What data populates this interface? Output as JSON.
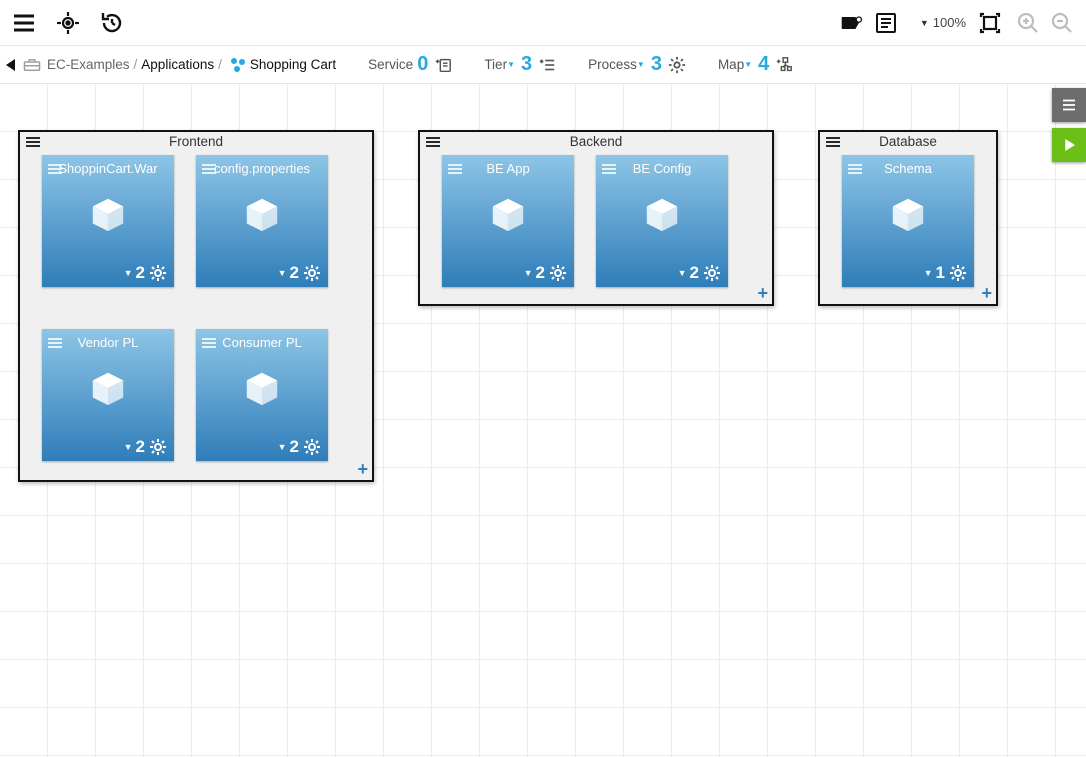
{
  "toolbar": {
    "zoom": "100%"
  },
  "breadcrumb": {
    "root": "EC-Examples",
    "mid": "Applications",
    "leaf": "Shopping Cart",
    "sep": "/"
  },
  "stats": {
    "service": {
      "label": "Service",
      "count": "0"
    },
    "tier": {
      "label": "Tier",
      "count": "3"
    },
    "process": {
      "label": "Process",
      "count": "3"
    },
    "map": {
      "label": "Map",
      "count": "4"
    }
  },
  "tiers": [
    {
      "name": "Frontend",
      "components": [
        {
          "title": "ShoppinCart.War",
          "count": "2"
        },
        {
          "title": "config.properties",
          "count": "2"
        },
        {
          "title": "Vendor PL",
          "count": "2"
        },
        {
          "title": "Consumer PL",
          "count": "2"
        }
      ]
    },
    {
      "name": "Backend",
      "components": [
        {
          "title": "BE App",
          "count": "2"
        },
        {
          "title": "BE Config",
          "count": "2"
        }
      ]
    },
    {
      "name": "Database",
      "components": [
        {
          "title": "Schema",
          "count": "1"
        }
      ]
    }
  ]
}
